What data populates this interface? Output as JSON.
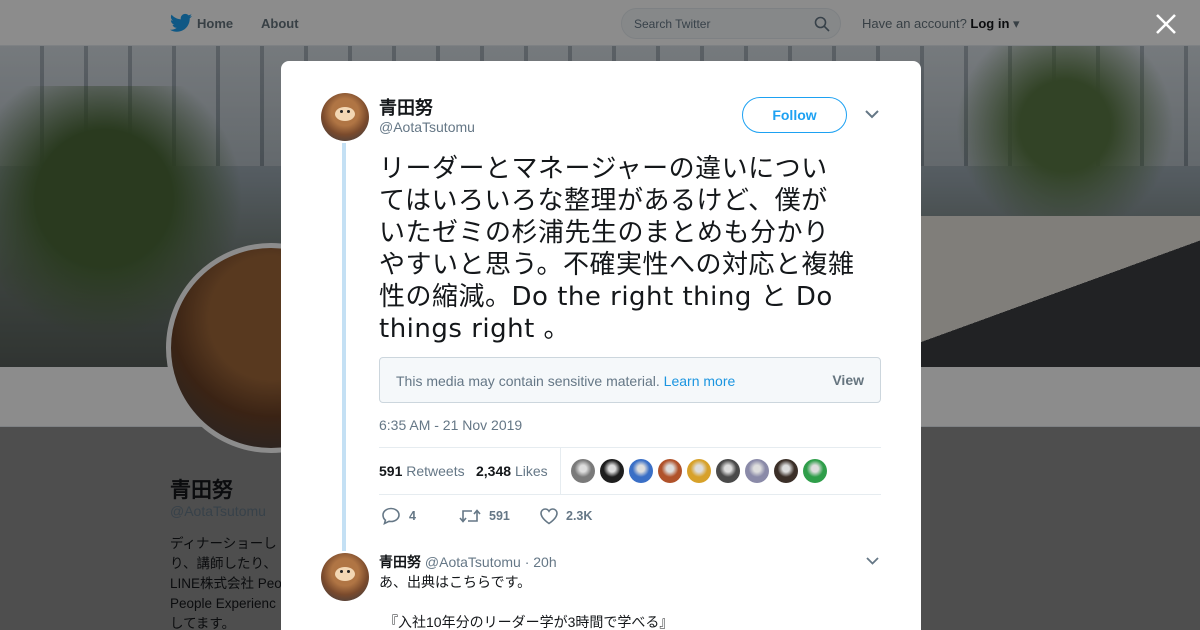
{
  "topbar": {
    "home_label": "Home",
    "about_label": "About",
    "search_placeholder": "Search Twitter",
    "account_prompt": "Have an account?",
    "login_label": "Log in"
  },
  "profile": {
    "name": "青田努",
    "handle": "@AotaTsutomu",
    "bio_lines": [
      "ディナーショーし",
      "り、講師したり、",
      "LINE株式会社 Peo",
      "People Experienc",
      "してます。"
    ]
  },
  "tweet": {
    "author_name": "青田努",
    "author_handle": "@AotaTsutomu",
    "follow_label": "Follow",
    "text_lines": [
      "リーダーとマネージャーの違いについ",
      "てはいろいろな整理があるけど、僕が",
      "いたゼミの杉浦先生のまとめも分かり",
      "やすいと思う。不確実性への対応と複雑",
      "性の縮減。Do the right thing と Do",
      "things right 。"
    ],
    "sensitive_message": "This media may contain sensitive material.",
    "learn_more": "Learn more",
    "view_label": "View",
    "timestamp": "6:35 AM - 21 Nov 2019",
    "retweets_count": "591",
    "retweets_label": "Retweets",
    "likes_count": "2,348",
    "likes_label": "Likes",
    "liker_colors": [
      "#7a7a7a",
      "#1e1e1e",
      "#3a6fc6",
      "#b0522a",
      "#d7a12a",
      "#4a4a4a",
      "#8a8aa8",
      "#3b2f28",
      "#2f9e4a"
    ],
    "reply_count": "4",
    "retweet_count": "591",
    "like_count": "2.3K"
  },
  "reply": {
    "name": "青田努",
    "handle": "@AotaTsutomu",
    "time": "· 20h",
    "text": "あ、出典はこちらです。",
    "text2": "『入社10年分のリーダー学が3時間で学べる』"
  },
  "colors": {
    "accent": "#1da1f2",
    "thread_line": "#c4e0f4"
  }
}
